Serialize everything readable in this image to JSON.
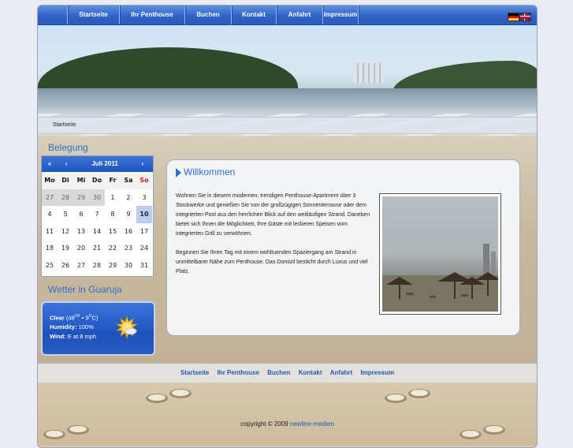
{
  "nav": {
    "items": [
      {
        "label": "Startseite"
      },
      {
        "label": "Ihr Penthouse"
      },
      {
        "label": "Buchen"
      },
      {
        "label": "Kontakt"
      },
      {
        "label": "Anfahrt"
      },
      {
        "label": "Impressum"
      }
    ],
    "flags": [
      "german-flag-icon",
      "uk-flag-icon"
    ]
  },
  "breadcrumb": "Startseite",
  "sidebar": {
    "booking_title": "Belegung",
    "weather_title": "Wetter in Guaruja"
  },
  "calendar": {
    "prev_year": "«",
    "prev_month": "‹",
    "month": "Juli 2011",
    "next_month": "›",
    "weekdays": [
      "Mo",
      "Di",
      "Mi",
      "Do",
      "Fr",
      "Sa",
      "So"
    ],
    "days": [
      [
        "27",
        "28",
        "29",
        "30",
        "1",
        "2",
        "3"
      ],
      [
        "4",
        "5",
        "6",
        "7",
        "8",
        "9",
        "10"
      ],
      [
        "11",
        "12",
        "13",
        "14",
        "15",
        "16",
        "17"
      ],
      [
        "18",
        "19",
        "20",
        "21",
        "22",
        "23",
        "24"
      ],
      [
        "25",
        "26",
        "27",
        "28",
        "29",
        "30",
        "31"
      ]
    ],
    "other_month_count": 4,
    "today": "10"
  },
  "weather": {
    "cond_label": "Clear",
    "temp_open": " (48",
    "unit_f": "OF",
    "temp_mid": " • 9",
    "unit_c": "O",
    "temp_close": "C)",
    "humidity_label": "Humidity:",
    "humidity_value": " 100%",
    "wind_label": "Wind:",
    "wind_value": " E at 8 mph",
    "icon": "sun-cloud-icon"
  },
  "content": {
    "title": "Willkommen",
    "para1": "Wohnen Sie in diesem modernen, trendigen Penthouse-Apartment über 3 Stockwerke und genießen Sie von der großzügigen Sonnenterrasse oder dem integrierten Pool aus den herrlichen Blick auf den weitläufigen Strand. Daneben bietet sich Ihnen die Möglichkeit, Ihre Gäste mit leckeren Speisen vom integrierten Grill zu verwöhnen.",
    "para2": "Beginnen Sie Ihren Tag mit einem wohltuenden Spaziergang am Strand in unmittelbarer Nähe zum Penthouse. Das Domizil besticht durch Luxus und viel Platz."
  },
  "footer": {
    "links": [
      "Startseite",
      "Ihr Penthouse",
      "Buchen",
      "Kontakt",
      "Anfahrt",
      "Impressum"
    ],
    "copyright_prefix": "copyright © 2009 ",
    "copyright_link": "newline-medien"
  }
}
